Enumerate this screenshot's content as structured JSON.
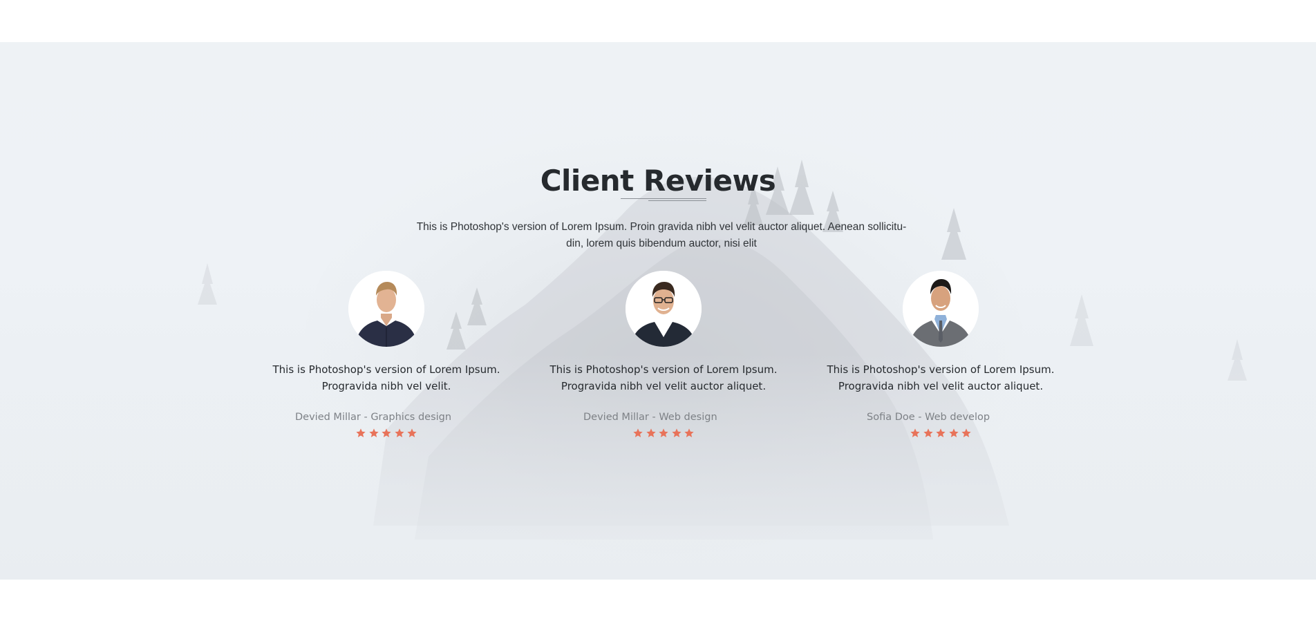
{
  "section": {
    "title": "Client Reviews",
    "description_line1": "This is Photoshop's version  of Lorem Ipsum. Proin gravida nibh vel velit auctor aliquet. Aenean sollicitu-",
    "description_line2": "din, lorem quis bibendum auctor, nisi elit"
  },
  "colors": {
    "star": "#e8735a",
    "title": "#262a2e",
    "author": "#7d8186"
  },
  "reviews": [
    {
      "quote_line1": "This is Photoshop's version  of Lorem Ipsum.",
      "quote_line2": "Progravida nibh vel velit.",
      "author": "Devied Millar - Graphics design",
      "rating": 5,
      "avatar_icon": "man-dark-shirt-avatar"
    },
    {
      "quote_line1": "This is Photoshop's version  of Lorem Ipsum.",
      "quote_line2": "Progravida nibh vel velit auctor aliquet.",
      "author": "Devied Millar - Web design",
      "rating": 5,
      "avatar_icon": "man-glasses-suit-avatar"
    },
    {
      "quote_line1": "This is Photoshop's version  of Lorem Ipsum.",
      "quote_line2": "Progravida nibh vel velit auctor aliquet.",
      "author": "Sofia Doe - Web develop",
      "rating": 5,
      "avatar_icon": "man-grey-suit-avatar"
    }
  ]
}
